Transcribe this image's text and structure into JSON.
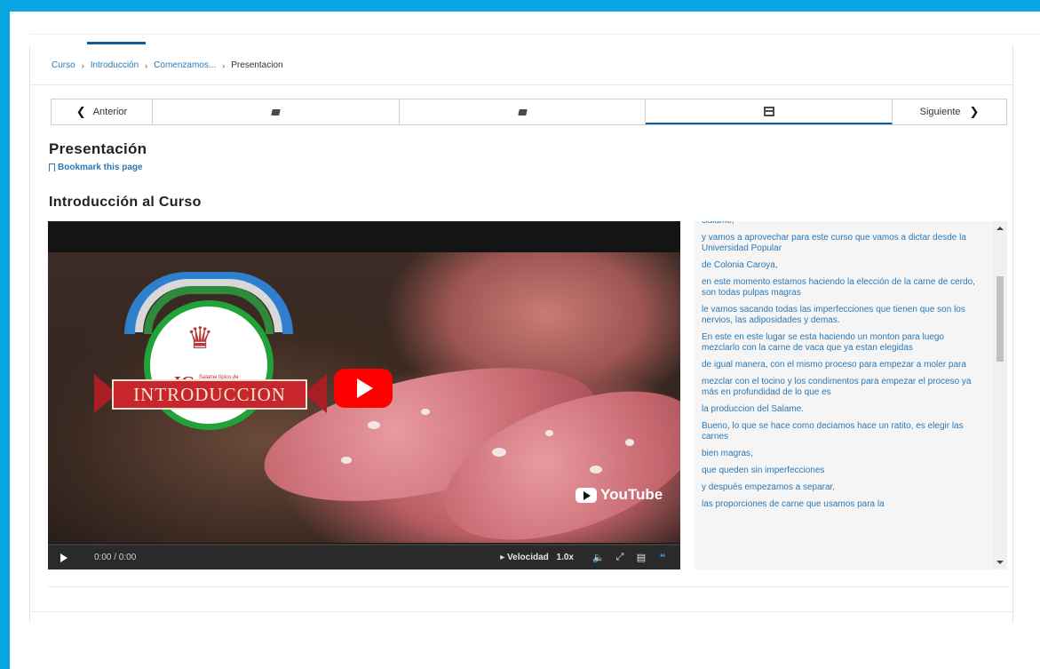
{
  "breadcrumb": {
    "items": [
      "Curso",
      "Introducción",
      "Comenzamos...",
      "Presentacion"
    ],
    "separator": "›"
  },
  "sequence_nav": {
    "prev_label": "Anterior",
    "next_label": "Siguiente",
    "units": [
      {
        "icon": "problem-icon",
        "active": false
      },
      {
        "icon": "problem-icon",
        "active": false
      },
      {
        "icon": "video-icon",
        "active": true
      }
    ]
  },
  "page": {
    "title": "Presentación",
    "bookmark_label": "Bookmark this page",
    "section_title": "Introducción al Curso"
  },
  "video": {
    "logo_ig": "IG",
    "logo_subtitle": "Salame típico de COLONIA CAROYA",
    "banner_text": "INTRODUCCION",
    "yt_brand": "YouTube",
    "time": "0:00 / 0:00",
    "speed_label": "Velocidad",
    "speed_value": "1.0x"
  },
  "transcript": [
    "Salame,",
    "y vamos a aprovechar para este curso que vamos a dictar desde la Universidad Popular",
    "de Colonia Caroya,",
    "en este momento estamos haciendo la elección de la carne de cerdo, son todas pulpas magras",
    "le vamos sacando todas las imperfecciones que tienen que son los nervios, las adiposidades y demas.",
    "En este en este lugar se esta haciendo un monton para luego mezclarlo con la carne de vaca que ya estan elegidas",
    "de igual manera, con el mismo proceso para empezar a moler para",
    "mezclar con el tocino y los condimentos para empezar el proceso ya más en profundidad de lo que es",
    "la produccion del Salame.",
    "Bueno, lo que se hace como deciamos hace un ratito, es elegir las carnes",
    "bien magras,",
    "que queden sin imperfecciones",
    "y después empezamos a separar,",
    "las proporciones de carne que usamos para la"
  ],
  "colors": {
    "accent": "#0aa6e4",
    "link": "#2c78b4",
    "active_tab": "#0b5f9e",
    "youtube_red": "#ff0000",
    "banner_red": "#c8252c"
  }
}
